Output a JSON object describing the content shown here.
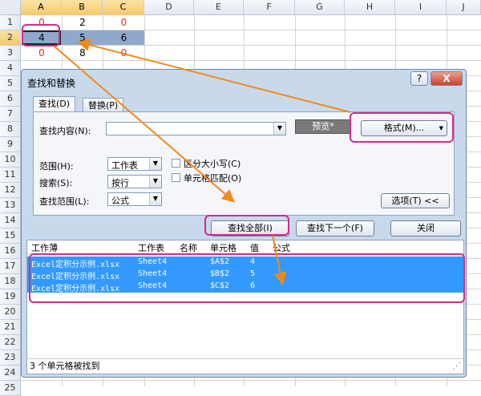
{
  "sheet": {
    "columns": [
      "A",
      "B",
      "C",
      "D",
      "E",
      "F",
      "G",
      "H",
      "I",
      "J"
    ],
    "rows": [
      "1",
      "2",
      "3",
      "4",
      "5",
      "6",
      "7",
      "8",
      "9",
      "10",
      "11",
      "12",
      "13",
      "14",
      "15",
      "16",
      "17",
      "18",
      "19",
      "20",
      "21",
      "22",
      "23",
      "24",
      "25"
    ],
    "cells": {
      "a1": "0",
      "b1": "2",
      "c1": "0",
      "a2": "4",
      "b2": "5",
      "c2": "6",
      "a3": "0",
      "b3": "8",
      "c3": "0"
    }
  },
  "dialog": {
    "title": "查找和替换",
    "help_label": "?",
    "close_label": "X",
    "tabs": [
      {
        "label": "查找(D)",
        "active": true
      },
      {
        "label": "替换(P)",
        "active": false
      }
    ],
    "find_what_label": "查找内容(N):",
    "find_what_value": "",
    "preview_label": "预览*",
    "format_button": "格式(M)...",
    "within_label": "范围(H):",
    "within_value": "工作表",
    "search_label": "搜索(S):",
    "search_value": "按行",
    "look_in_label": "查找范围(L):",
    "look_in_value": "公式",
    "match_case_label": "区分大小写(C)",
    "match_entire_label": "单元格匹配(O)",
    "options_button": "选项(T) <<",
    "find_all_button": "查找全部(I)",
    "find_next_button": "查找下一个(F)",
    "close_button": "关闭",
    "results": {
      "headers": [
        "工作薄",
        "工作表",
        "名称",
        "单元格",
        "值",
        "公式"
      ],
      "rows": [
        [
          "Excel定积分示例.xlsx",
          "Sheet4",
          "",
          "$A$2",
          "4",
          ""
        ],
        [
          "Excel定积分示例.xlsx",
          "Sheet4",
          "",
          "$B$2",
          "5",
          ""
        ],
        [
          "Excel定积分示例.xlsx",
          "Sheet4",
          "",
          "$C$2",
          "6",
          ""
        ]
      ]
    },
    "status": "3 个单元格被找到"
  },
  "colors": {
    "annotation_arrow": "#f08a1c",
    "annotation_highlight": "#cf2d8e",
    "result_selection": "#3399ff",
    "zero_value": "#e0302a"
  }
}
